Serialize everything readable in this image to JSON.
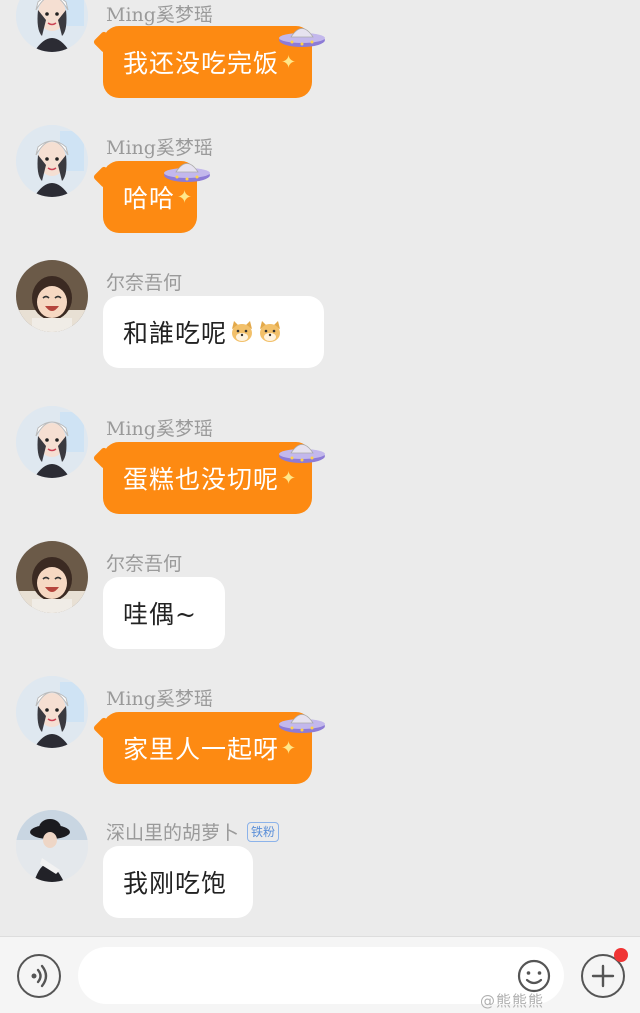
{
  "messages": [
    {
      "sender": "Ming奚梦瑶",
      "text": "我还没吃完饭",
      "avatar": "girl-white-cap-avatar",
      "bubble_color": "#fd8a12",
      "decoration": "ufo-icon"
    },
    {
      "sender": "Ming奚梦瑶",
      "text": "哈哈",
      "avatar": "girl-white-cap-avatar",
      "bubble_color": "#fd8a12",
      "decoration": "ufo-icon"
    },
    {
      "sender": "尔奈吾何",
      "text": "和誰吃呢",
      "avatar": "smiling-child-avatar",
      "bubble_color": "#ffffff",
      "emoji": "shiba-dog-emoji"
    },
    {
      "sender": "Ming奚梦瑶",
      "text": "蛋糕也没切呢",
      "avatar": "girl-white-cap-avatar",
      "bubble_color": "#fd8a12",
      "decoration": "ufo-icon"
    },
    {
      "sender": "尔奈吾何",
      "text": "哇偶~",
      "avatar": "smiling-child-avatar",
      "bubble_color": "#ffffff"
    },
    {
      "sender": "Ming奚梦瑶",
      "text": "家里人一起呀",
      "avatar": "girl-white-cap-avatar",
      "bubble_color": "#fd8a12",
      "decoration": "ufo-icon"
    },
    {
      "sender": "深山里的胡萝卜",
      "badge": "铁粉",
      "text": "我刚吃饱",
      "avatar": "woman-black-hat-avatar",
      "bubble_color": "#ffffff"
    }
  ],
  "input_bar": {
    "placeholder": "",
    "icons": [
      "voice-icon",
      "emoji-smile-icon",
      "plus-icon"
    ],
    "notification_dot_color": "#f03434"
  },
  "watermark": "@熊熊熊"
}
